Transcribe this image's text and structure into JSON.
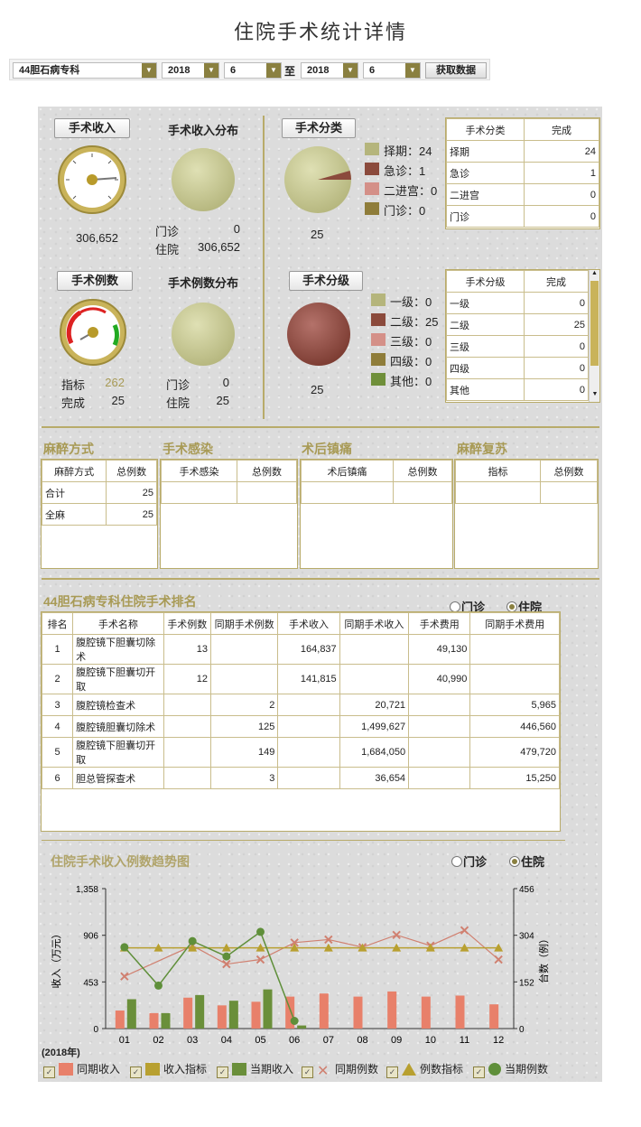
{
  "page_title": "住院手术统计详情",
  "toolbar": {
    "dept": "44胆石病专科",
    "from_year": "2018",
    "from_month": "6",
    "to_label": "至",
    "to_year": "2018",
    "to_month": "6",
    "fetch_label": "获取数据"
  },
  "revenue": {
    "btn": "手术收入",
    "dist_title": "手术收入分布",
    "gauge_value": "306,652",
    "outpatient_label": "门诊",
    "outpatient_value": "0",
    "inpatient_label": "住院",
    "inpatient_value": "306,652"
  },
  "category": {
    "btn": "手术分类",
    "pie_total": "25",
    "legend": [
      {
        "label": "择期：24",
        "color": "#b5b57c"
      },
      {
        "label": "急诊：1",
        "color": "#8b4a3c"
      },
      {
        "label": "二进宫：0",
        "color": "#d49088"
      },
      {
        "label": "门诊：0",
        "color": "#8f7d3a"
      }
    ],
    "table_headers": [
      "手术分类",
      "完成"
    ],
    "table_rows": [
      [
        "择期",
        "24"
      ],
      [
        "急诊",
        "1"
      ],
      [
        "二进宫",
        "0"
      ],
      [
        "门诊",
        "0"
      ]
    ]
  },
  "cases": {
    "btn": "手术例数",
    "dist_title": "手术例数分布",
    "target_label": "指标",
    "target_value": "262",
    "done_label": "完成",
    "done_value": "25",
    "outpatient_label": "门诊",
    "outpatient_value": "0",
    "inpatient_label": "住院",
    "inpatient_value": "25"
  },
  "grade": {
    "btn": "手术分级",
    "pie_total": "25",
    "legend": [
      {
        "label": "一级：0",
        "color": "#b5b57c"
      },
      {
        "label": "二级：25",
        "color": "#8b4a3c"
      },
      {
        "label": "三级：0",
        "color": "#d49088"
      },
      {
        "label": "四级：0",
        "color": "#8f7d3a"
      },
      {
        "label": "其他：0",
        "color": "#6f8f3a"
      }
    ],
    "table_headers": [
      "手术分级",
      "完成"
    ],
    "table_rows": [
      [
        "一级",
        "0"
      ],
      [
        "二级",
        "25"
      ],
      [
        "三级",
        "0"
      ],
      [
        "四级",
        "0"
      ],
      [
        "其他",
        "0"
      ]
    ]
  },
  "anesthesia": {
    "title": "麻醉方式",
    "headers": [
      "麻醉方式",
      "总例数"
    ],
    "rows": [
      [
        "合计",
        "25"
      ],
      [
        "全麻",
        "25"
      ]
    ]
  },
  "infection": {
    "title": "手术感染",
    "headers": [
      "手术感染",
      "总例数"
    ]
  },
  "sedation": {
    "title": "术后镇痛",
    "headers": [
      "术后镇痛",
      "总例数"
    ]
  },
  "recovery": {
    "title": "麻醉复苏",
    "headers": [
      "指标",
      "总例数"
    ]
  },
  "ranking": {
    "title": "44胆石病专科住院手术排名",
    "radio_out": "门诊",
    "radio_in": "住院",
    "headers": [
      "排名",
      "手术名称",
      "手术例数",
      "同期手术例数",
      "手术收入",
      "同期手术收入",
      "手术费用",
      "同期手术费用"
    ],
    "rows": [
      [
        "1",
        "腹腔镜下胆囊切除术",
        "13",
        "",
        "164,837",
        "",
        "49,130",
        ""
      ],
      [
        "2",
        "腹腔镜下胆囊切开取",
        "12",
        "",
        "141,815",
        "",
        "40,990",
        ""
      ],
      [
        "3",
        "腹腔镜检查术",
        "",
        "2",
        "",
        "20,721",
        "",
        "5,965"
      ],
      [
        "4",
        "腹腔镜胆囊切除术",
        "",
        "125",
        "",
        "1,499,627",
        "",
        "446,560"
      ],
      [
        "5",
        "腹腔镜下胆囊切开取",
        "",
        "149",
        "",
        "1,684,050",
        "",
        "479,720"
      ],
      [
        "6",
        "胆总管探查术",
        "",
        "3",
        "",
        "36,654",
        "",
        "15,250"
      ]
    ]
  },
  "trend": {
    "title": "住院手术收入例数趋势图",
    "radio_out": "门诊",
    "radio_in": "住院",
    "year_label": "(2018年)",
    "ylabel_left": "收入（万元）",
    "ylabel_right": "台数（例）",
    "legend": [
      {
        "label": "同期收入",
        "color": "#e8806a",
        "icon": "bar"
      },
      {
        "label": "收入指标",
        "color": "#b8a030",
        "icon": "bar"
      },
      {
        "label": "当期收入",
        "color": "#6a8f3a",
        "icon": "bar"
      },
      {
        "label": "同期例数",
        "color": "#d08070",
        "icon": "cross"
      },
      {
        "label": "例数指标",
        "color": "#b8a030",
        "icon": "triangle"
      },
      {
        "label": "当期例数",
        "color": "#5f8f3a",
        "icon": "circle"
      }
    ]
  },
  "chart_data": {
    "type": "bar",
    "categories": [
      "01",
      "02",
      "03",
      "04",
      "05",
      "06",
      "07",
      "08",
      "09",
      "10",
      "11",
      "12"
    ],
    "y_left": {
      "ticks": [
        "0",
        "453",
        "906",
        "1,358"
      ],
      "ylim": [
        0,
        1358
      ]
    },
    "y_right": {
      "ticks": [
        "0",
        "152",
        "304",
        "456"
      ],
      "ylim": [
        0,
        456
      ]
    },
    "series": [
      {
        "name": "同期收入",
        "kind": "bar",
        "axis": "left",
        "values": [
          175,
          150,
          300,
          225,
          260,
          310,
          340,
          310,
          360,
          310,
          320,
          235
        ]
      },
      {
        "name": "当期收入",
        "kind": "bar",
        "axis": "left",
        "values": [
          285,
          150,
          325,
          270,
          380,
          30,
          null,
          null,
          null,
          null,
          null,
          null
        ]
      },
      {
        "name": "同期例数",
        "kind": "line",
        "axis": "right",
        "values": [
          170,
          null,
          270,
          210,
          225,
          280,
          290,
          265,
          305,
          270,
          320,
          225
        ]
      },
      {
        "name": "例数指标",
        "kind": "line",
        "axis": "right",
        "values": [
          263,
          263,
          263,
          263,
          263,
          263,
          263,
          263,
          263,
          263,
          263,
          263
        ]
      },
      {
        "name": "当期例数",
        "kind": "line",
        "axis": "right",
        "values": [
          265,
          140,
          285,
          235,
          315,
          25,
          null,
          null,
          null,
          null,
          null,
          null
        ]
      }
    ]
  }
}
